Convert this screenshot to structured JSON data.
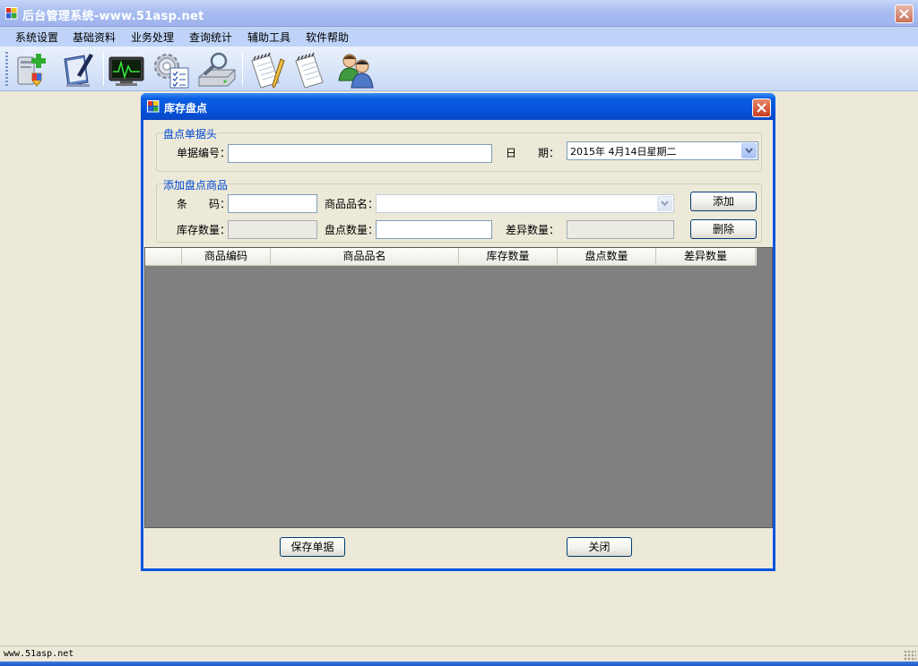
{
  "main_window": {
    "title": "后台管理系统-www.51asp.net"
  },
  "menu": {
    "items": [
      "系统设置",
      "基础资料",
      "业务处理",
      "查询统计",
      "辅助工具",
      "软件帮助"
    ]
  },
  "toolbar": {
    "buttons": [
      {
        "icon": "add-user-computer-icon"
      },
      {
        "icon": "notebook-pen-icon"
      },
      {
        "icon": "monitor-pulse-icon"
      },
      {
        "icon": "settings-checklist-icon"
      },
      {
        "icon": "drive-search-icon"
      },
      {
        "icon": "notepad-icon"
      },
      {
        "icon": "notepad-icon"
      },
      {
        "icon": "users-icon"
      }
    ]
  },
  "dialog": {
    "title": "库存盘点",
    "header_group": {
      "legend": "盘点单据头",
      "doc_no_label": "单据编号：",
      "doc_no_value": "",
      "date_label": "日　　期：",
      "date_value": "2015年 4月14日星期二"
    },
    "goods_group": {
      "legend": "添加盘点商品",
      "barcode_label": "条　　码：",
      "barcode_value": "",
      "name_label": "商品品名：",
      "name_value": "",
      "stock_qty_label": "库存数量：",
      "stock_qty_value": "",
      "count_qty_label": "盘点数量：",
      "count_qty_value": "",
      "diff_qty_label": "差异数量：",
      "diff_qty_value": "",
      "add_button": "添加",
      "delete_button": "删除"
    },
    "grid": {
      "columns": [
        "商品编码",
        "商品品名",
        "库存数量",
        "盘点数量",
        "差异数量"
      ],
      "rows": []
    },
    "save_button": "保存单据",
    "close_button": "关闭"
  },
  "statusbar": {
    "text": "www.51asp.net"
  },
  "colors": {
    "dialog_title": "#0855dd",
    "group_legend": "#0046d5",
    "grid_background": "#808080",
    "face": "#ece9d8"
  }
}
